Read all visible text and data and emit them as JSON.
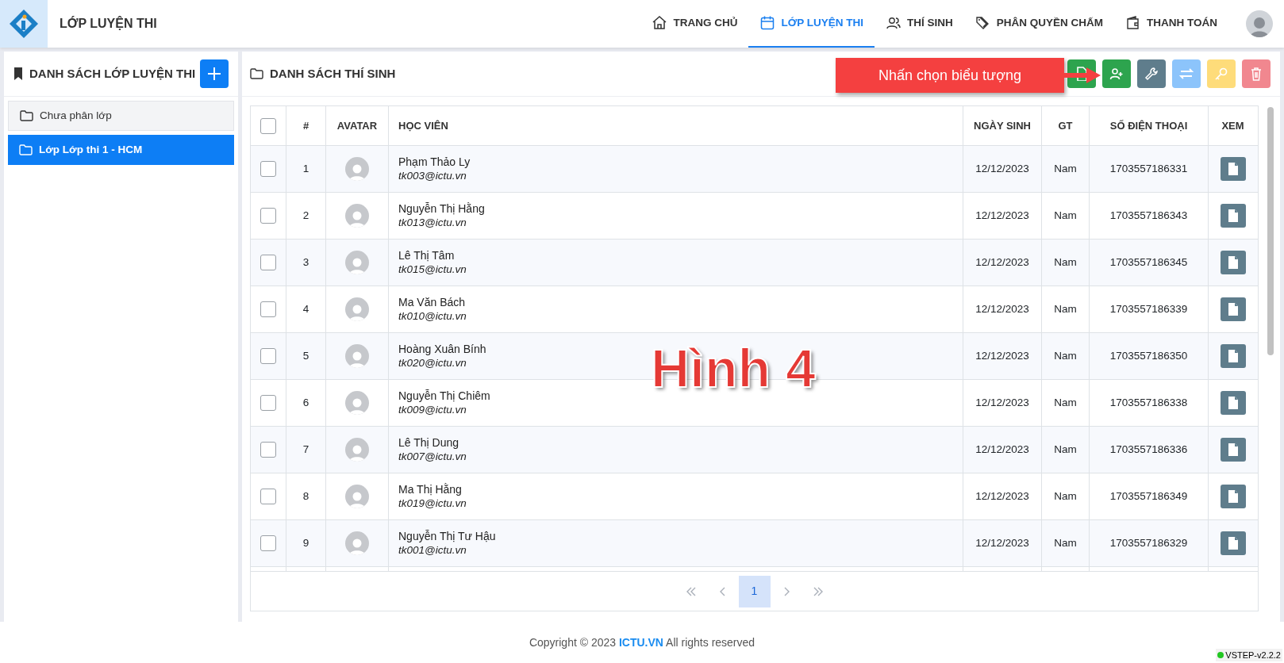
{
  "app": {
    "title": "LỚP LUYỆN THI"
  },
  "nav": [
    {
      "label": "TRANG CHỦ",
      "selected": false
    },
    {
      "label": "LỚP LUYỆN THI",
      "selected": true
    },
    {
      "label": "THÍ SINH",
      "selected": false
    },
    {
      "label": "PHÂN QUYỀN CHẤM",
      "selected": false
    },
    {
      "label": "THANH TOÁN",
      "selected": false
    }
  ],
  "sidebar": {
    "title": "DANH SÁCH LỚP LUYỆN THI",
    "items": [
      {
        "label": "Chưa phân lớp",
        "selected": false
      },
      {
        "label": "Lớp Lớp thi 1 - HCM",
        "selected": true
      }
    ]
  },
  "panel": {
    "title": "DANH SÁCH THÍ SINH",
    "toolbar": [
      {
        "color": "#2da44e"
      },
      {
        "color": "#2da44e"
      },
      {
        "color": "#5f7d8c"
      },
      {
        "color": "#8cc4fb"
      },
      {
        "color": "#fedc7a"
      },
      {
        "color": "#f1878f"
      }
    ]
  },
  "table": {
    "select_all": {
      "checked": false
    },
    "columns": [
      "#",
      "AVATAR",
      "HỌC VIÊN",
      "NGÀY SINH",
      "GT",
      "SỐ ĐIỆN THOẠI",
      "XEM"
    ],
    "rows": [
      {
        "checked": false,
        "index": "1",
        "name": "Phạm Thảo Ly",
        "email": "tk003@ictu.vn",
        "dob": "12/12/2023",
        "gender": "Nam",
        "phone": "1703557186331"
      },
      {
        "checked": false,
        "index": "2",
        "name": "Nguyễn Thị Hằng",
        "email": "tk013@ictu.vn",
        "dob": "12/12/2023",
        "gender": "Nam",
        "phone": "1703557186343"
      },
      {
        "checked": false,
        "index": "3",
        "name": "Lê Thị Tâm",
        "email": "tk015@ictu.vn",
        "dob": "12/12/2023",
        "gender": "Nam",
        "phone": "1703557186345"
      },
      {
        "checked": false,
        "index": "4",
        "name": "Ma Văn Bách",
        "email": "tk010@ictu.vn",
        "dob": "12/12/2023",
        "gender": "Nam",
        "phone": "1703557186339"
      },
      {
        "checked": false,
        "index": "5",
        "name": "Hoàng Xuân Bính",
        "email": "tk020@ictu.vn",
        "dob": "12/12/2023",
        "gender": "Nam",
        "phone": "1703557186350"
      },
      {
        "checked": false,
        "index": "6",
        "name": "Nguyễn Thị Chiêm",
        "email": "tk009@ictu.vn",
        "dob": "12/12/2023",
        "gender": "Nam",
        "phone": "1703557186338"
      },
      {
        "checked": false,
        "index": "7",
        "name": "Lê Thị Dung",
        "email": "tk007@ictu.vn",
        "dob": "12/12/2023",
        "gender": "Nam",
        "phone": "1703557186336"
      },
      {
        "checked": false,
        "index": "8",
        "name": "Ma Thị Hằng",
        "email": "tk019@ictu.vn",
        "dob": "12/12/2023",
        "gender": "Nam",
        "phone": "1703557186349"
      },
      {
        "checked": false,
        "index": "9",
        "name": "Nguyễn Thị Tư Hậu",
        "email": "tk001@ictu.vn",
        "dob": "12/12/2023",
        "gender": "Nam",
        "phone": "1703557186329"
      }
    ]
  },
  "pagination": {
    "pages": [
      {
        "label": "1",
        "selected": true
      }
    ]
  },
  "footer": {
    "prefix": "Copyright © 2023",
    "link": "ICTU.VN",
    "suffix": "All rights reserved",
    "version": "VSTEP-v2.2.2"
  },
  "annotation": {
    "callout": "Nhấn chọn biểu tượng",
    "figure_label": "Hình 4"
  }
}
